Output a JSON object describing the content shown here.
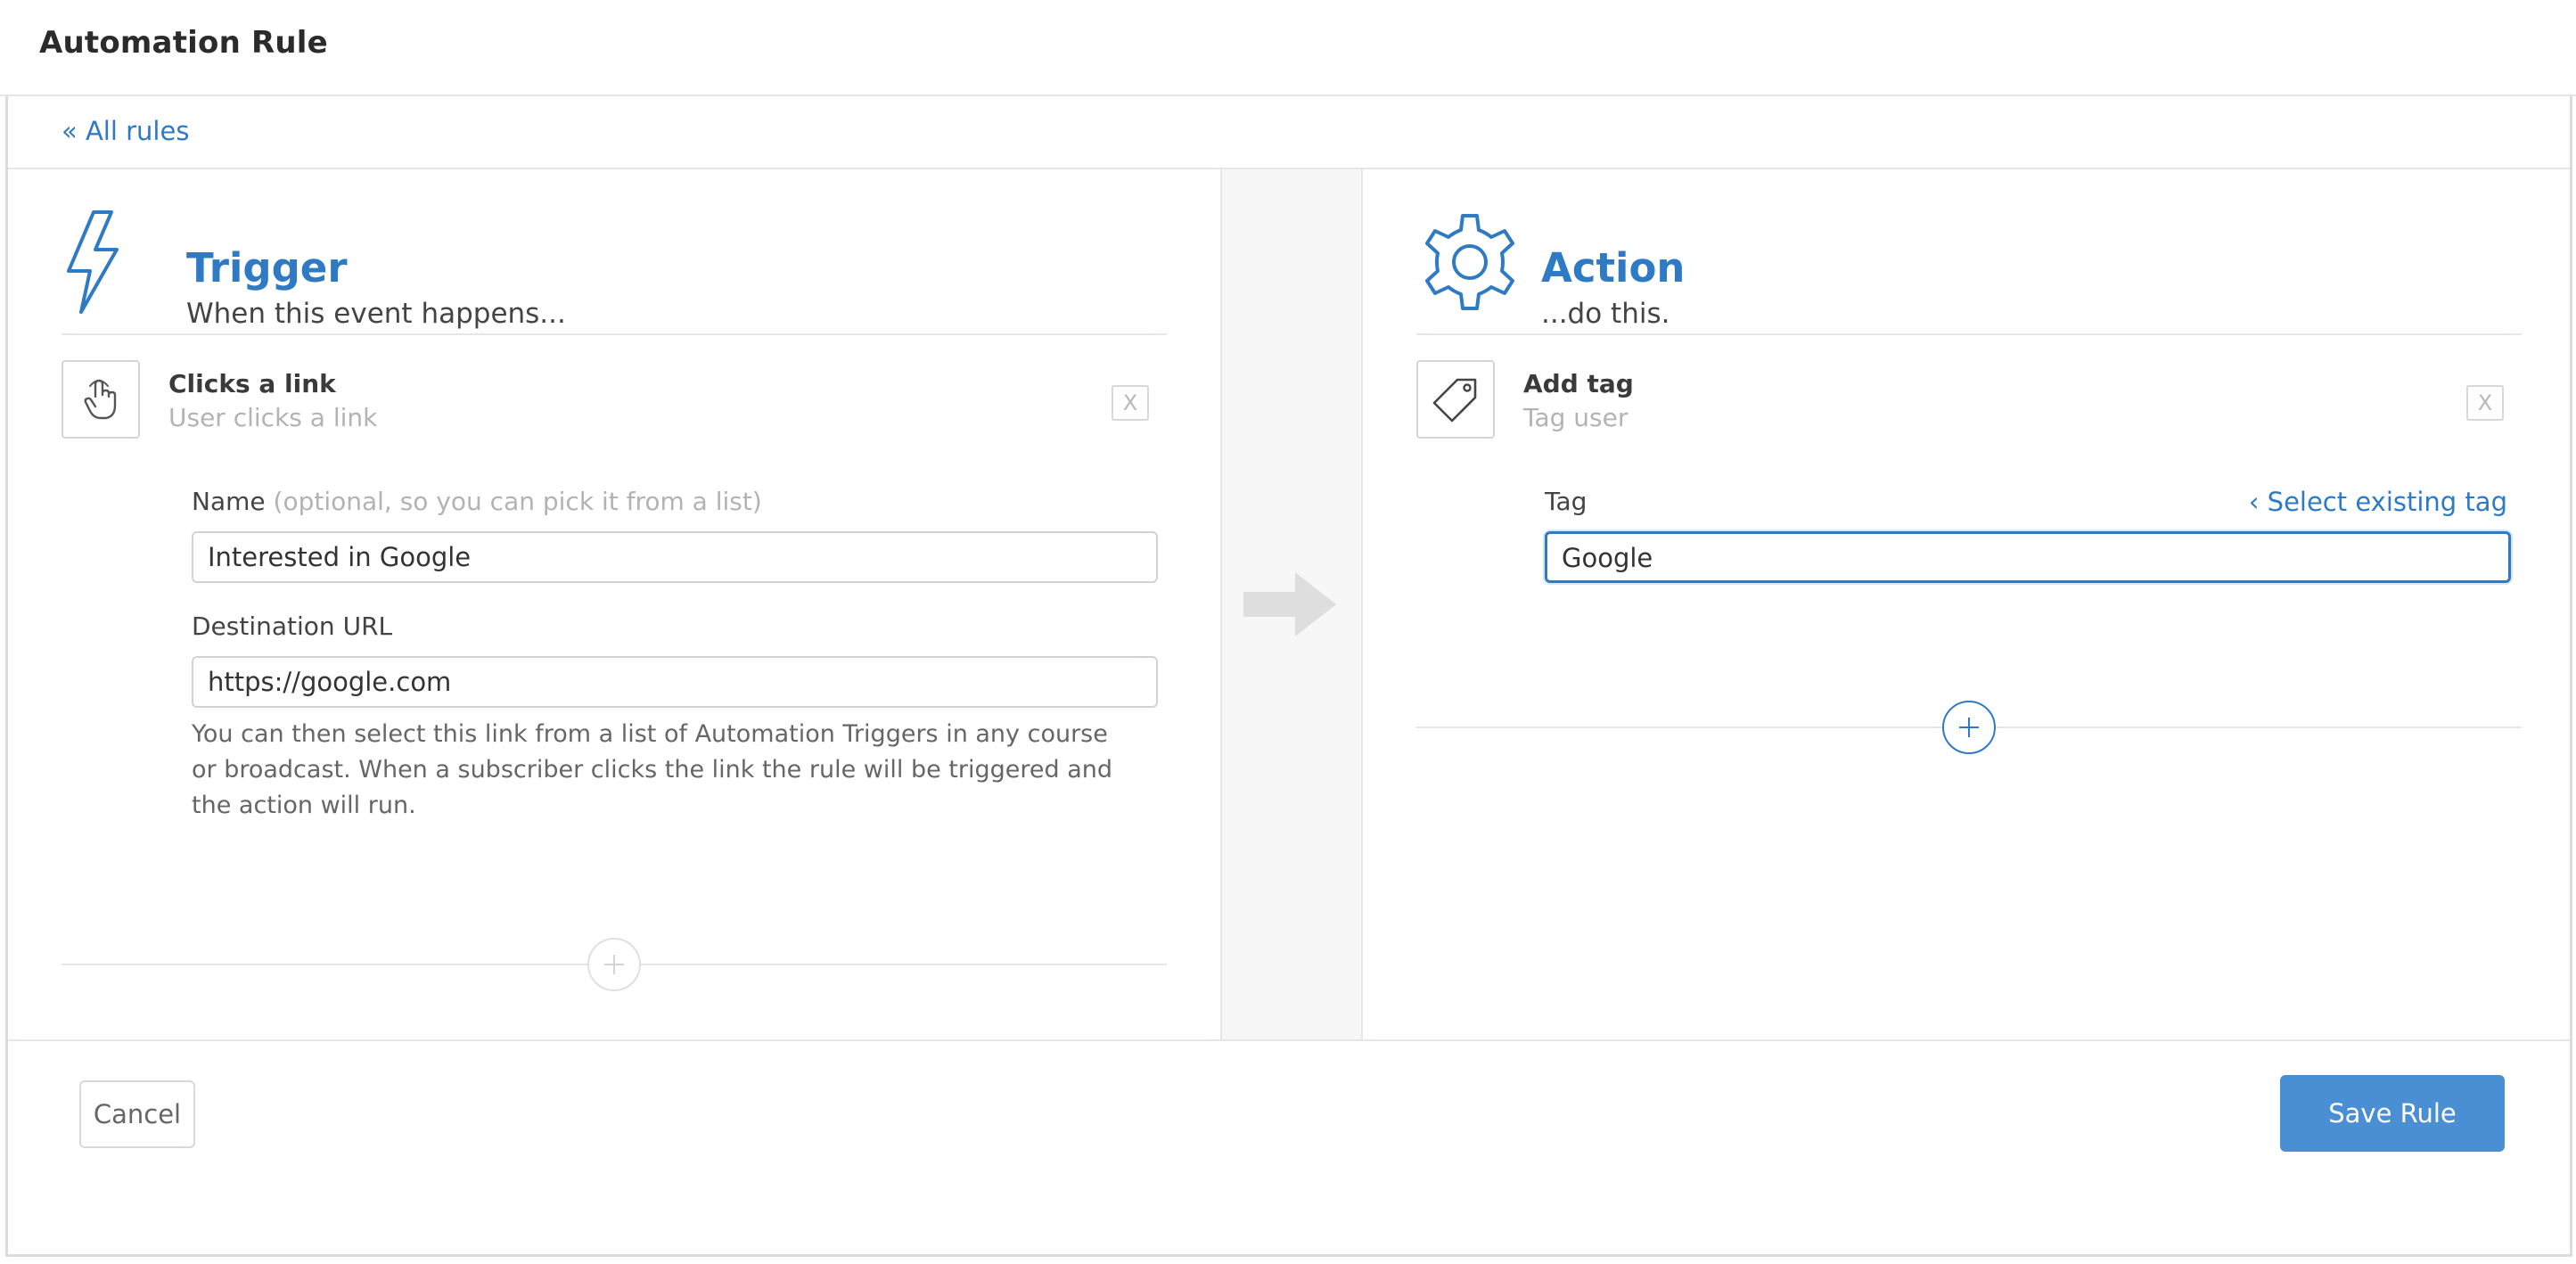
{
  "header": {
    "title": "Automation Rule"
  },
  "breadcrumb": {
    "label": "« All rules"
  },
  "trigger": {
    "title": "Trigger",
    "subtitle": "When this event happens...",
    "item": {
      "name": "Clicks a link",
      "description": "User clicks a link",
      "remove_label": "X"
    },
    "name_field": {
      "label": "Name",
      "hint": "(optional, so you can pick it from a list)",
      "value": "Interested in Google"
    },
    "url_field": {
      "label": "Destination URL",
      "value": "https://google.com"
    },
    "help_text": "You can then select this link from a list of Automation Triggers in any course or broadcast. When a subscriber clicks the link the rule will be triggered and the action will run.",
    "add_label": "+"
  },
  "action": {
    "title": "Action",
    "subtitle": "...do this.",
    "item": {
      "name": "Add tag",
      "description": "Tag user",
      "remove_label": "X"
    },
    "tag_field": {
      "label": "Tag",
      "select_existing": "‹ Select existing tag",
      "value": "Google"
    },
    "add_label": "+"
  },
  "footer": {
    "cancel_label": "Cancel",
    "save_label": "Save Rule"
  },
  "colors": {
    "accent": "#2f7ac4",
    "button_primary": "#4a8fd4"
  }
}
